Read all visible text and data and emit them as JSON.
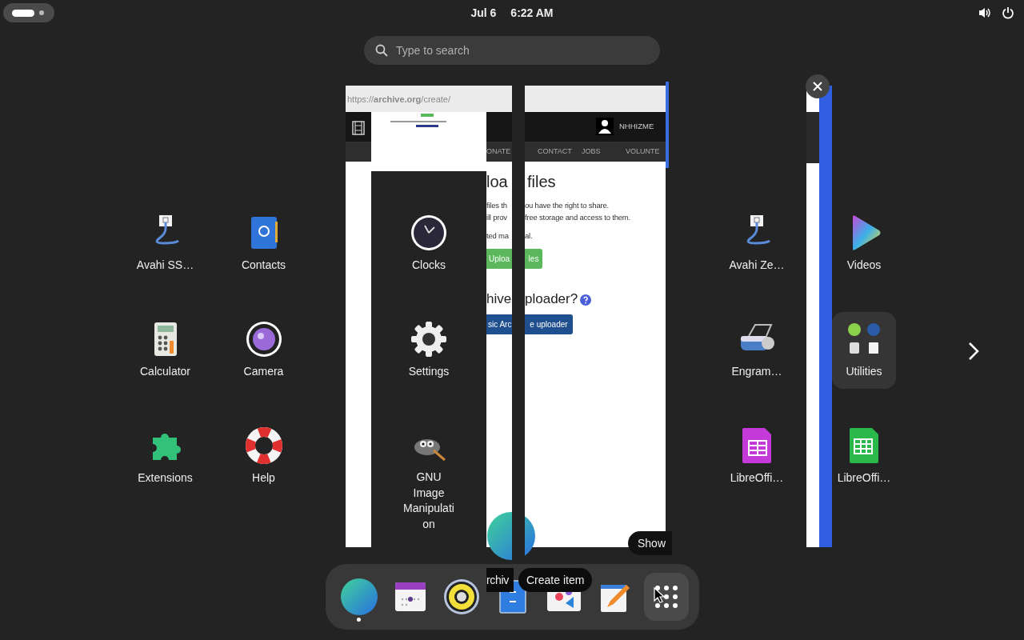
{
  "top_bar": {
    "date": "Jul 6",
    "time": "6:22 AM"
  },
  "search": {
    "placeholder": "Type to search"
  },
  "left_apps": [
    {
      "label": "Avahi SS…",
      "kind": "cable"
    },
    {
      "label": "Contacts",
      "kind": "contacts"
    },
    {
      "label": "Calculator",
      "kind": "calculator"
    },
    {
      "label": "Camera",
      "kind": "camera"
    },
    {
      "label": "Extensions",
      "kind": "puzzle"
    },
    {
      "label": "Help",
      "kind": "lifebuoy"
    }
  ],
  "window_preview": {
    "url": "https://**archive.org**/create/",
    "user": "NHHIZME",
    "nav_fragment": "ONATE",
    "nav": [
      "CONTACT",
      "JOBS",
      "VOLUNTE"
    ],
    "left_part": {
      "heading": "loa",
      "lines": [
        "files th",
        "ill prov",
        "ted ma"
      ],
      "upload_button": "Uploa",
      "heading_2": "hive",
      "uploader_button": "sic Arc"
    },
    "right_part": {
      "heading": "files",
      "lines": [
        "ou have the right to share.",
        "free storage and access to them.",
        "al."
      ],
      "upload_button": "les",
      "heading_2": "ploader?",
      "uploader_button": "e uploader"
    },
    "tooltip": "Show"
  },
  "gap_apps": [
    {
      "label": "Clocks",
      "kind": "clock"
    },
    {
      "label": "Settings",
      "kind": "gear"
    },
    {
      "label": "GNU Image Manipulation",
      "kind": "critter"
    }
  ],
  "right_apps": [
    {
      "label": "Avahi Ze…",
      "kind": "cable"
    },
    {
      "label": "Engram…",
      "kind": "scanner"
    },
    {
      "label": "LibreOffi…",
      "kind": "base"
    }
  ],
  "far_right_apps": [
    {
      "label": "Videos",
      "kind": "play"
    },
    {
      "label": "Utilities",
      "kind": "folder"
    },
    {
      "label": "LibreOffi…",
      "kind": "calc"
    }
  ],
  "dock_tooltips": [
    "rchiv",
    "Create item"
  ],
  "dock": [
    {
      "kind": "globe",
      "running": true,
      "selected": false
    },
    {
      "kind": "calendar",
      "running": false,
      "selected": false
    },
    {
      "kind": "speaker",
      "running": false,
      "selected": false
    },
    {
      "kind": "cabinet",
      "running": false,
      "selected": false
    },
    {
      "kind": "photos",
      "running": false,
      "selected": false
    },
    {
      "kind": "editor",
      "running": false,
      "selected": false
    },
    {
      "kind": "grid",
      "running": false,
      "selected": true
    }
  ]
}
